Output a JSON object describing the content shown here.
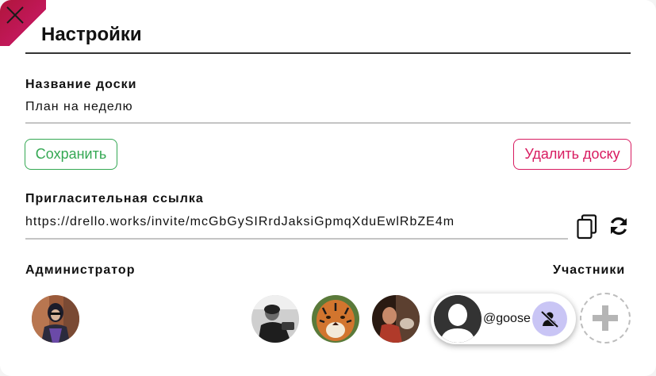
{
  "dialog": {
    "title": "Настройки",
    "close_icon": "close-icon"
  },
  "board_name": {
    "label": "Название доски",
    "value": "План на неделю"
  },
  "actions": {
    "save_label": "Сохранить",
    "delete_label": "Удалить доску"
  },
  "invite": {
    "label": "Пригласительная ссылка",
    "link": "https://drello.works/invite/mcGbGySIRrdJaksiGpmqXduEwlRbZE4m",
    "copy_icon": "copy-icon",
    "refresh_icon": "refresh-icon"
  },
  "admin": {
    "label": "Администратор"
  },
  "members": {
    "label": "Участники",
    "highlighted_username": "@goose",
    "remove_icon": "remove-user-icon",
    "add_icon": "plus-icon"
  },
  "colors": {
    "close_accent": "#b0153b",
    "save_accent": "#34a853",
    "delete_accent": "#d81b60",
    "remove_button_bg": "#c9c5f5"
  }
}
